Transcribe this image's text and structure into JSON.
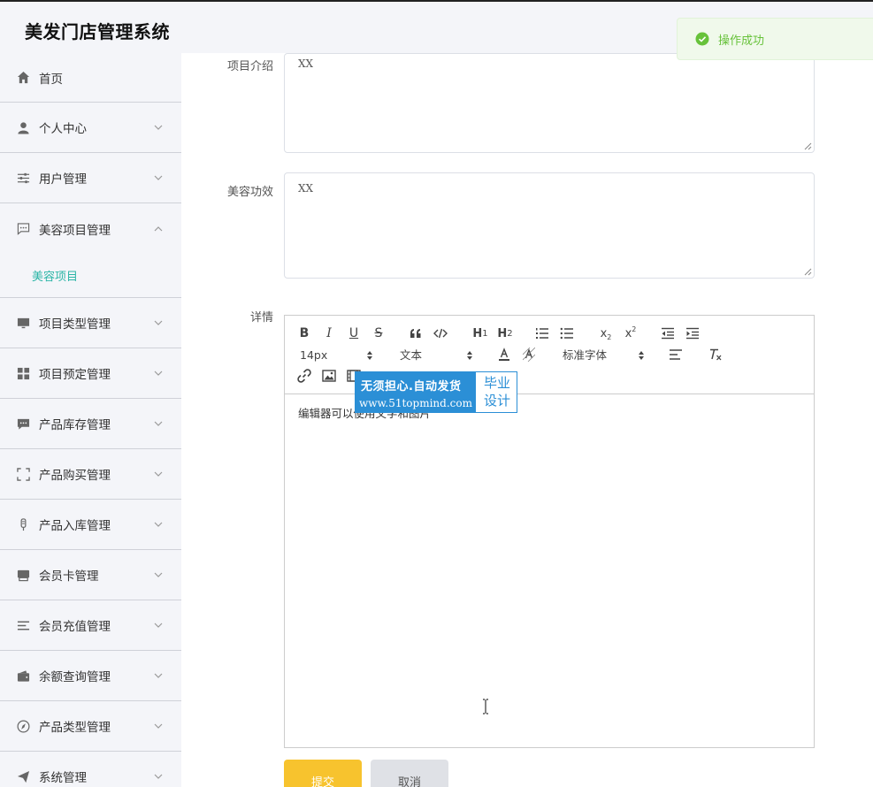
{
  "app": {
    "title": "美发门店管理系统"
  },
  "toast": {
    "text": "操作成功"
  },
  "sidebar": {
    "items": [
      {
        "label": "首页",
        "icon": "home-icon"
      },
      {
        "label": "个人中心",
        "icon": "user-icon"
      },
      {
        "label": "用户管理",
        "icon": "sliders-icon"
      },
      {
        "label": "美容项目管理",
        "icon": "chat-icon",
        "expanded": true
      },
      {
        "label": "项目类型管理",
        "icon": "monitor-icon"
      },
      {
        "label": "项目预定管理",
        "icon": "grid-icon"
      },
      {
        "label": "产品库存管理",
        "icon": "message-icon"
      },
      {
        "label": "产品购买管理",
        "icon": "fullscreen-icon"
      },
      {
        "label": "产品入库管理",
        "icon": "microphone-icon"
      },
      {
        "label": "会员卡管理",
        "icon": "printer-icon"
      },
      {
        "label": "会员充值管理",
        "icon": "list-icon"
      },
      {
        "label": "余额查询管理",
        "icon": "wallet-icon"
      },
      {
        "label": "产品类型管理",
        "icon": "compass-icon"
      },
      {
        "label": "系统管理",
        "icon": "send-icon"
      }
    ],
    "submenu": {
      "label": "美容项目"
    }
  },
  "form": {
    "intro_label": "项目介绍",
    "intro_value": "XX",
    "effect_label": "美容功效",
    "effect_value": "XX",
    "detail_label": "详情"
  },
  "editor": {
    "font_size": "14px",
    "heading": "文本",
    "font_family": "标准字体",
    "content": "编辑器可以使用文字和图片"
  },
  "watermark": {
    "line1": "无须担心.自动发货",
    "line2": "www.51topmind.com",
    "right1": "毕业",
    "right2": "设计"
  },
  "buttons": {
    "submit": "提交",
    "cancel": "取消"
  },
  "colors": {
    "accent": "#2bb5a6",
    "submit": "#f7c32e",
    "success": "#67c23a",
    "watermark": "#2b8fd6"
  }
}
